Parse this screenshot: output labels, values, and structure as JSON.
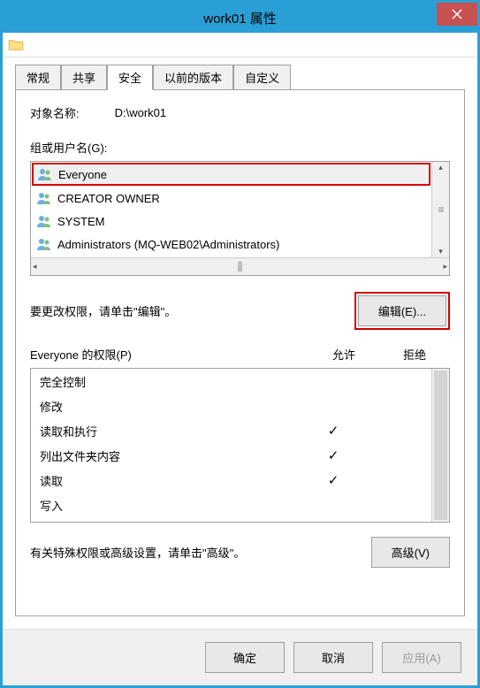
{
  "window": {
    "title": "work01 属性"
  },
  "tabs": [
    "常规",
    "共享",
    "安全",
    "以前的版本",
    "自定义"
  ],
  "active_tab": 2,
  "object": {
    "label": "对象名称:",
    "value": "D:\\work01"
  },
  "groups": {
    "label": "组或用户名(G):",
    "items": [
      "Everyone",
      "CREATOR OWNER",
      "SYSTEM",
      "Administrators (MQ-WEB02\\Administrators)"
    ]
  },
  "edit": {
    "prompt": "要更改权限，请单击\"编辑\"。",
    "button": "编辑(E)..."
  },
  "permissions": {
    "header_prefix": "的权限(P)",
    "subject": "Everyone",
    "allow_label": "允许",
    "deny_label": "拒绝",
    "rows": [
      {
        "name": "完全控制",
        "allow": false,
        "deny": false
      },
      {
        "name": "修改",
        "allow": false,
        "deny": false
      },
      {
        "name": "读取和执行",
        "allow": true,
        "deny": false
      },
      {
        "name": "列出文件夹内容",
        "allow": true,
        "deny": false
      },
      {
        "name": "读取",
        "allow": true,
        "deny": false
      },
      {
        "name": "写入",
        "allow": false,
        "deny": false
      }
    ]
  },
  "advanced": {
    "text": "有关特殊权限或高级设置，请单击\"高级\"。",
    "button": "高级(V)"
  },
  "buttons": {
    "ok": "确定",
    "cancel": "取消",
    "apply": "应用(A)"
  }
}
